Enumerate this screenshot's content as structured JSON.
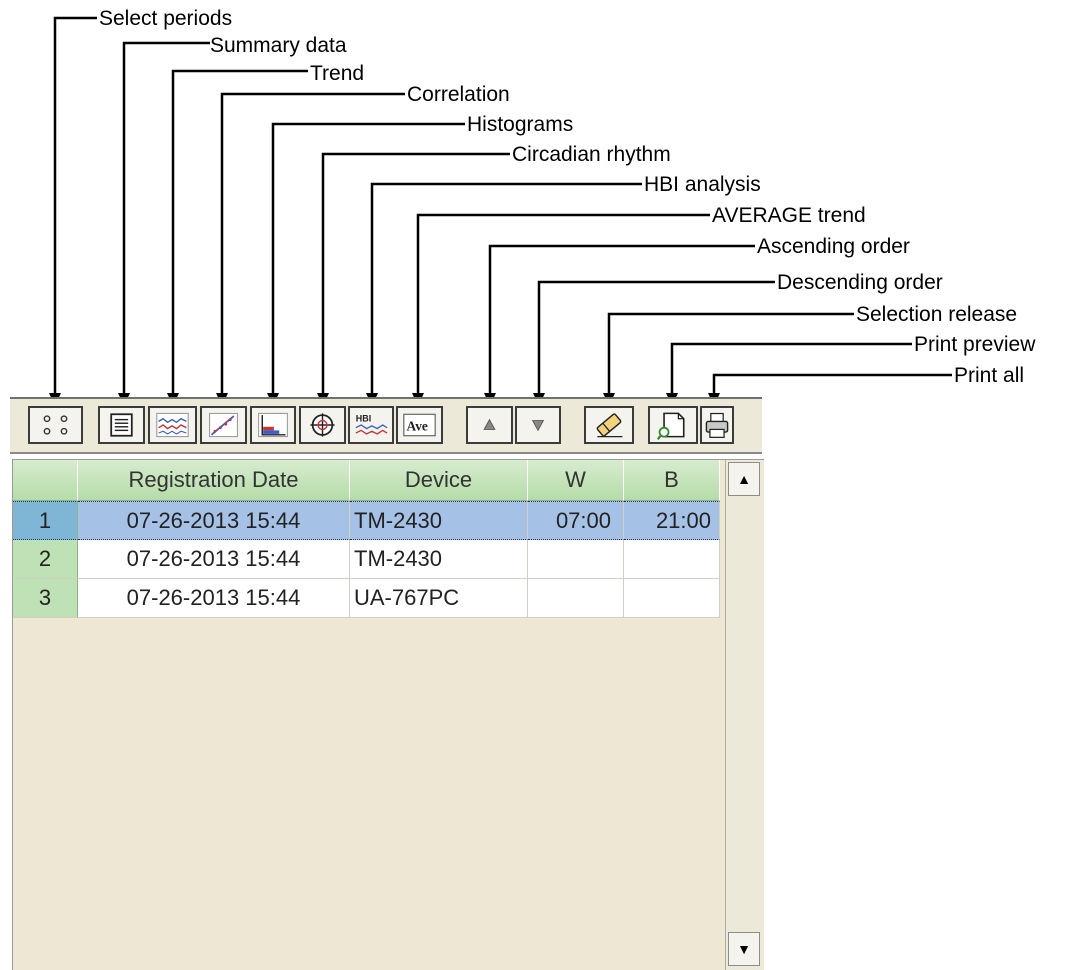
{
  "callouts": [
    "Select periods",
    "Summary data",
    "Trend",
    "Correlation",
    "Histograms",
    "Circadian rhythm",
    "HBI analysis",
    "AVERAGE trend",
    "Ascending order",
    "Descending order",
    "Selection release",
    "Print preview",
    "Print all"
  ],
  "toolbar": {
    "buttons": [
      {
        "icon": "select-periods-icon"
      },
      {
        "icon": "summary-data-icon"
      },
      {
        "icon": "trend-icon"
      },
      {
        "icon": "correlation-icon"
      },
      {
        "icon": "histogram-icon"
      },
      {
        "icon": "circadian-rhythm-icon"
      },
      {
        "icon": "hbi-analysis-icon",
        "glyph": "HBI"
      },
      {
        "icon": "average-trend-icon",
        "glyph": "Ave"
      },
      {
        "icon": "ascending-order-icon"
      },
      {
        "icon": "descending-order-icon"
      },
      {
        "icon": "selection-release-icon"
      },
      {
        "icon": "print-preview-icon"
      },
      {
        "icon": "print-all-icon"
      }
    ]
  },
  "grid": {
    "columns": [
      "",
      "Registration Date",
      "Device",
      "W",
      "B"
    ],
    "rows": [
      {
        "num": "1",
        "date": "07-26-2013 15:44",
        "device": "TM-2430",
        "w": "07:00",
        "b": "21:00",
        "selected": true
      },
      {
        "num": "2",
        "date": "07-26-2013 15:44",
        "device": "TM-2430",
        "w": "",
        "b": "",
        "selected": false
      },
      {
        "num": "3",
        "date": "07-26-2013 15:44",
        "device": "UA-767PC",
        "w": "",
        "b": "",
        "selected": false
      }
    ]
  },
  "scrollbar": {
    "up": "▲",
    "down": "▼"
  },
  "colors": {
    "header": "#b5dca8",
    "selected_row": "#a6c1e6",
    "grid_background": "#ede7d4"
  }
}
